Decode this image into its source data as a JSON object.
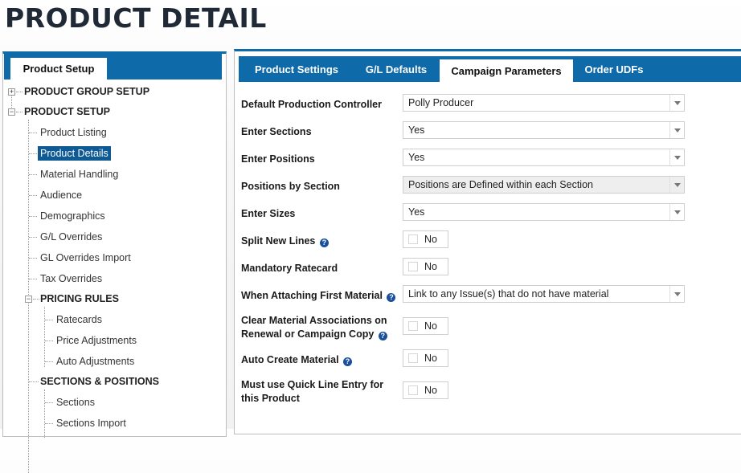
{
  "page": {
    "title": "PRODUCT DETAIL"
  },
  "left_panel": {
    "tab_label": "Product Setup",
    "tree": {
      "product_group_setup": "PRODUCT GROUP SETUP",
      "product_setup": "PRODUCT SETUP",
      "product_listing": "Product Listing",
      "product_details": "Product Details",
      "material_handling": "Material Handling",
      "audience": "Audience",
      "demographics": "Demographics",
      "gl_overrides": "G/L Overrides",
      "gl_overrides_import": "GL Overrides Import",
      "tax_overrides": "Tax Overrides",
      "pricing_rules": "PRICING RULES",
      "ratecards": "Ratecards",
      "price_adjustments": "Price Adjustments",
      "auto_adjustments": "Auto Adjustments",
      "sections_positions": "SECTIONS & POSITIONS",
      "sections": "Sections",
      "sections_import": "Sections Import"
    },
    "selected_item": "Product Details"
  },
  "tabs": {
    "product_settings": "Product Settings",
    "gl_defaults": "G/L Defaults",
    "campaign_parameters": "Campaign Parameters",
    "order_udfs": "Order UDFs",
    "active": "Campaign Parameters"
  },
  "form": {
    "default_production_controller": {
      "label": "Default Production Controller",
      "value": "Polly Producer"
    },
    "enter_sections": {
      "label": "Enter Sections",
      "value": "Yes"
    },
    "enter_positions": {
      "label": "Enter Positions",
      "value": "Yes"
    },
    "positions_by_section": {
      "label": "Positions by Section",
      "value": "Positions are Defined within each Section"
    },
    "enter_sizes": {
      "label": "Enter Sizes",
      "value": "Yes"
    },
    "split_new_lines": {
      "label": "Split New Lines",
      "value": "No"
    },
    "mandatory_ratecard": {
      "label": "Mandatory Ratecard",
      "value": "No"
    },
    "when_attaching_first_material": {
      "label": "When Attaching First Material",
      "value": "Link to any Issue(s) that do not have material"
    },
    "clear_material_associations": {
      "label_line1": "Clear Material Associations on",
      "label_line2": "Renewal or Campaign Copy",
      "value": "No"
    },
    "auto_create_material": {
      "label": "Auto Create Material",
      "value": "No"
    },
    "must_use_quick_line_entry": {
      "label_line1": "Must use Quick Line Entry for",
      "label_line2": "this Product",
      "value": "No"
    }
  },
  "icons": {
    "help": "?",
    "help_icon_color": "#1a4f9c"
  },
  "colors": {
    "accent": "#0e6aa8",
    "selected": "#0e5a94"
  }
}
